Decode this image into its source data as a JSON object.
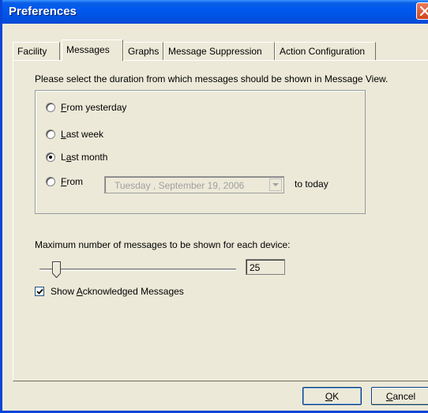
{
  "window": {
    "title": "Preferences"
  },
  "tabs": [
    {
      "label": "Facility",
      "active": false
    },
    {
      "label": "Messages",
      "active": true
    },
    {
      "label": "Graphs",
      "active": false
    },
    {
      "label": "Message Suppression",
      "active": false
    },
    {
      "label": "Action Configuration",
      "active": false
    }
  ],
  "messages": {
    "instruction": "Please select the duration from which messages should be shown in Message View.",
    "options": [
      {
        "prefix": "",
        "mnemonic": "F",
        "rest": "rom yesterday",
        "selected": false
      },
      {
        "prefix": "",
        "mnemonic": "L",
        "rest": "ast week",
        "selected": false
      },
      {
        "prefix": "L",
        "mnemonic": "a",
        "rest": "st month",
        "selected": true
      },
      {
        "prefix": "",
        "mnemonic": "F",
        "rest": "rom",
        "selected": false
      }
    ],
    "date_value": "Tuesday  , September 19, 2006",
    "to_today": "to today",
    "max_label": "Maximum number of messages to be shown for each device:",
    "max_value": "25",
    "show_ack": {
      "prefix": "Show ",
      "mnemonic": "A",
      "rest": "cknowledged Messages",
      "checked": true
    }
  },
  "buttons": {
    "ok": {
      "mnemonic": "O",
      "rest": "K"
    },
    "cancel": {
      "mnemonic": "C",
      "rest": "ancel"
    }
  }
}
